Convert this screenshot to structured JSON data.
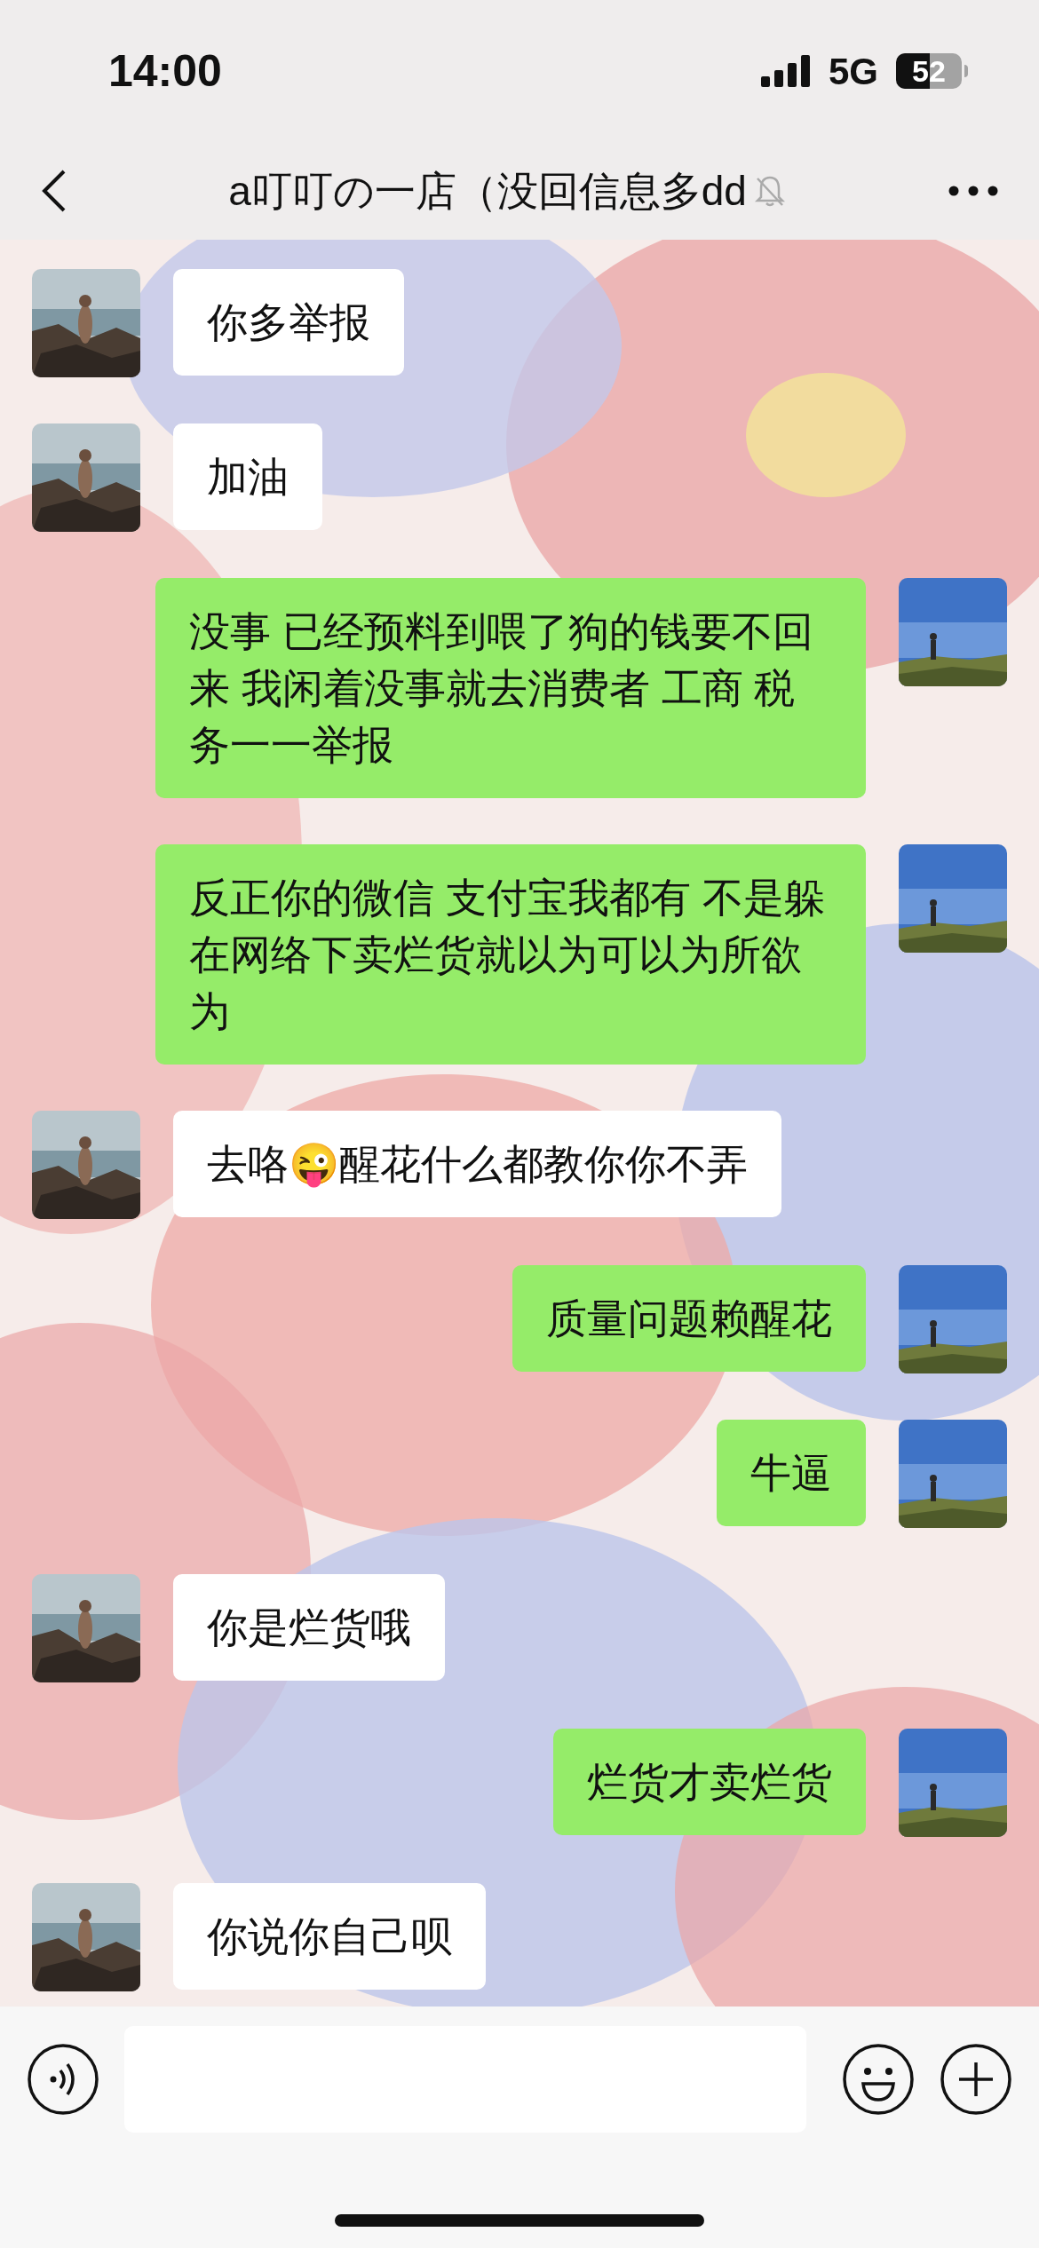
{
  "status_bar": {
    "time": "14:00",
    "network": "5G",
    "battery": "52"
  },
  "header": {
    "title": "a叮叮の一店（没回信息多dd",
    "muted": true
  },
  "messages": [
    {
      "kind": "received",
      "text": "你多举报"
    },
    {
      "kind": "received",
      "text": "加油"
    },
    {
      "kind": "sent",
      "text": "没事 已经预料到喂了狗的钱要不回来 我闲着没事就去消费者 工商 税务一一举报"
    },
    {
      "kind": "sent",
      "text": "反正你的微信 支付宝我都有 不是躲在网络下卖烂货就以为可以为所欲为"
    },
    {
      "kind": "received",
      "text": "去咯😜醒花什么都教你你不弄"
    },
    {
      "kind": "sent",
      "text": "质量问题赖醒花"
    },
    {
      "kind": "sent",
      "text": "牛逼"
    },
    {
      "kind": "received",
      "text": "你是烂货哦"
    },
    {
      "kind": "sent",
      "text": "烂货才卖烂货"
    },
    {
      "kind": "received",
      "text": "你说你自己呗"
    }
  ]
}
